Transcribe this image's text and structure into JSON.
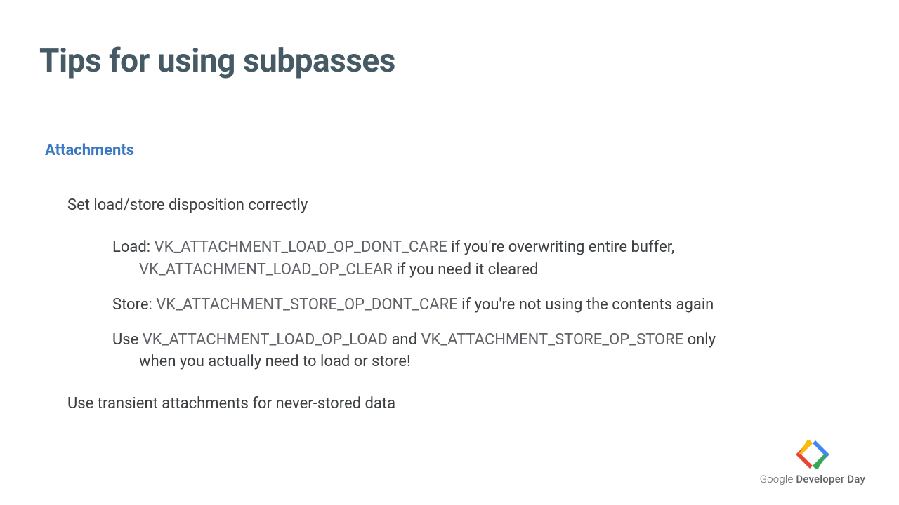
{
  "title": "Tips for using subpasses",
  "section": "Attachments",
  "body": {
    "intro": "Set load/store disposition correctly",
    "load": {
      "label": "Load: ",
      "c1": "VK_ATTACHMENT_LOAD_OP_DONT_CARE",
      "t1": " if you're overwriting entire buffer,",
      "c2": "VK_ATTACHMENT_LOAD_OP_CLEAR",
      "t2": " if you need it cleared"
    },
    "store": {
      "label": "Store: ",
      "c1": "VK_ATTACHMENT_STORE_OP_DONT_CARE",
      "t1": " if you're not using the contents again"
    },
    "use": {
      "pre": "Use ",
      "c1": "VK_ATTACHMENT_LOAD_OP_LOAD",
      "mid": " and ",
      "c2": "VK_ATTACHMENT_STORE_OP_STORE",
      "post": " only",
      "line2": "when you actually need to load or store!"
    },
    "transient": "Use transient attachments for never-stored data"
  },
  "footer": {
    "brand1": "Google",
    "brand2": " Developer Day"
  }
}
